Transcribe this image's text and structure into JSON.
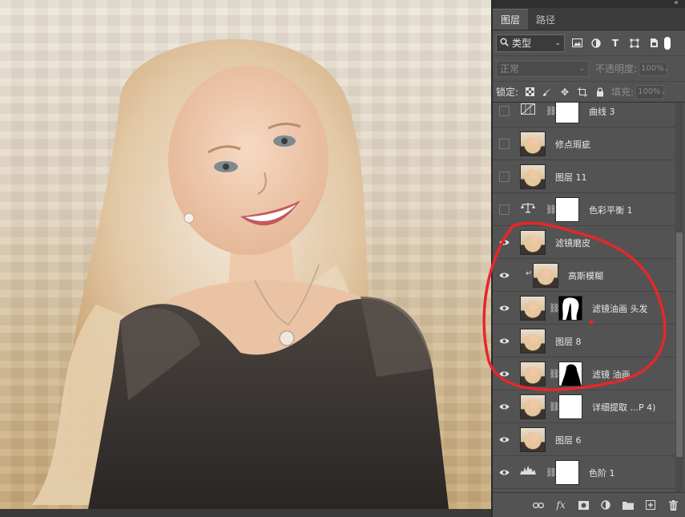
{
  "panel": {
    "collapse_glyph": "«",
    "tabs": [
      {
        "label": "图层",
        "active": true
      },
      {
        "label": "路径",
        "active": false
      }
    ],
    "filter": {
      "kind_label": "类型",
      "icons": [
        "image-filter-icon",
        "adjustment-filter-icon",
        "type-filter-icon",
        "shape-filter-icon",
        "smart-object-filter-icon"
      ]
    },
    "blend": {
      "mode": "正常",
      "opacity_label": "不透明度:",
      "opacity_value": "100%"
    },
    "lock": {
      "label": "锁定:",
      "fill_label": "填充:",
      "fill_value": "100%"
    },
    "layers": [
      {
        "name": "曲线 3",
        "visible": false,
        "kind": "adjustment",
        "icon": "curves-icon",
        "has_mask": true
      },
      {
        "name": "修点瑕疵",
        "visible": false,
        "kind": "pixel"
      },
      {
        "name": "图层 11",
        "visible": false,
        "kind": "pixel"
      },
      {
        "name": "色彩平衡 1",
        "visible": false,
        "kind": "adjustment",
        "icon": "balance-icon",
        "has_mask": true
      },
      {
        "name": "滤镜磨皮",
        "visible": true,
        "kind": "pixel"
      },
      {
        "name": "高斯模糊",
        "visible": true,
        "kind": "pixel",
        "clipped": true
      },
      {
        "name": "滤镜油画 头发",
        "visible": true,
        "kind": "pixel",
        "has_mask": true,
        "mask": "hair"
      },
      {
        "name": "图层 8",
        "visible": true,
        "kind": "pixel"
      },
      {
        "name": "滤镜 油画",
        "visible": true,
        "kind": "pixel",
        "has_mask": true,
        "mask": "figure"
      },
      {
        "name": "详细提取 ...P 4)",
        "visible": true,
        "kind": "pixel",
        "has_mask": true
      },
      {
        "name": "图层 6",
        "visible": true,
        "kind": "pixel"
      },
      {
        "name": "色阶 1",
        "visible": true,
        "kind": "adjustment",
        "icon": "levels-icon",
        "has_mask": true
      }
    ],
    "bottom_icons": [
      "link-layers-icon",
      "fx-icon",
      "add-mask-icon",
      "new-adjustment-icon",
      "new-group-icon",
      "new-layer-icon",
      "delete-layer-icon"
    ],
    "fx_label": "fx"
  },
  "colors": {
    "annotation": "#e8262a",
    "panel_bg": "#535353"
  }
}
